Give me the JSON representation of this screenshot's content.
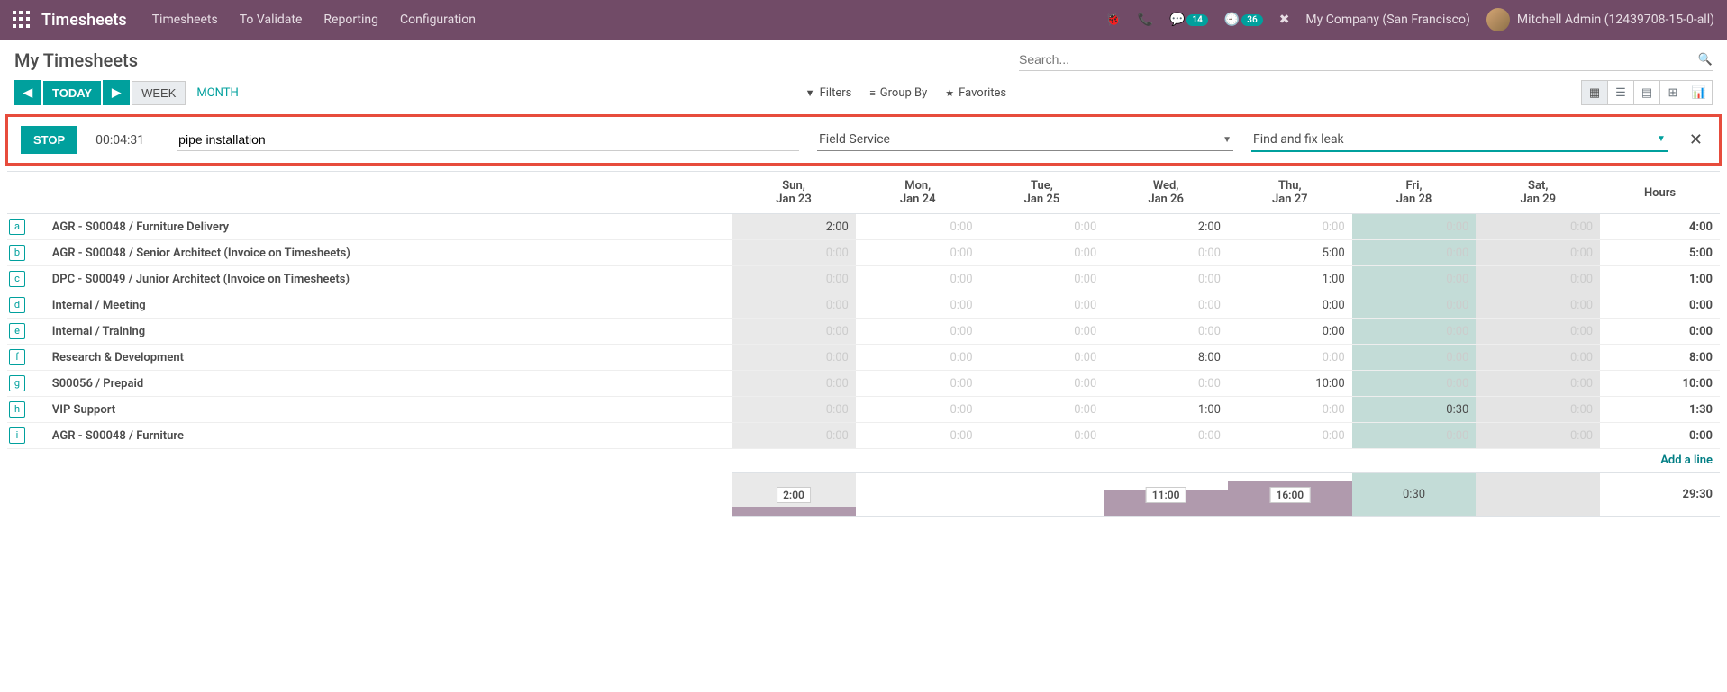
{
  "topbar": {
    "brand": "Timesheets",
    "nav": [
      "Timesheets",
      "To Validate",
      "Reporting",
      "Configuration"
    ],
    "messages_badge": "14",
    "activities_badge": "36",
    "company": "My Company (San Francisco)",
    "user": "Mitchell Admin (12439708-15-0-all)"
  },
  "header": {
    "title": "My Timesheets",
    "search_placeholder": "Search..."
  },
  "controls": {
    "today": "TODAY",
    "week": "WEEK",
    "month": "MONTH",
    "filters": "Filters",
    "group_by": "Group By",
    "favorites": "Favorites"
  },
  "timer": {
    "stop": "STOP",
    "elapsed": "00:04:31",
    "description": "pipe installation",
    "project": "Field Service",
    "task": "Find and fix leak"
  },
  "columns": {
    "sun": {
      "d": "Sun,",
      "n": "Jan 23"
    },
    "mon": {
      "d": "Mon,",
      "n": "Jan 24"
    },
    "tue": {
      "d": "Tue,",
      "n": "Jan 25"
    },
    "wed": {
      "d": "Wed,",
      "n": "Jan 26"
    },
    "thu": {
      "d": "Thu,",
      "n": "Jan 27"
    },
    "fri": {
      "d": "Fri,",
      "n": "Jan 28"
    },
    "sat": {
      "d": "Sat,",
      "n": "Jan 29"
    },
    "hours": "Hours"
  },
  "rows": [
    {
      "key": "a",
      "label": "AGR - S00048  /  Furniture Delivery",
      "cells": [
        "2:00",
        "0:00",
        "0:00",
        "2:00",
        "0:00",
        "0:00",
        "0:00"
      ],
      "total": "4:00",
      "nz": [
        0,
        3
      ]
    },
    {
      "key": "b",
      "label": "AGR - S00048  /  Senior Architect (Invoice on Timesheets)",
      "cells": [
        "0:00",
        "0:00",
        "0:00",
        "0:00",
        "5:00",
        "0:00",
        "0:00"
      ],
      "total": "5:00",
      "nz": [
        4
      ]
    },
    {
      "key": "c",
      "label": "DPC - S00049  /  Junior Architect (Invoice on Timesheets)",
      "cells": [
        "0:00",
        "0:00",
        "0:00",
        "0:00",
        "1:00",
        "0:00",
        "0:00"
      ],
      "total": "1:00",
      "nz": [
        4
      ]
    },
    {
      "key": "d",
      "label": "Internal  /  Meeting",
      "cells": [
        "0:00",
        "0:00",
        "0:00",
        "0:00",
        "0:00",
        "0:00",
        "0:00"
      ],
      "total": "0:00",
      "nz": [
        4
      ]
    },
    {
      "key": "e",
      "label": "Internal  /  Training",
      "cells": [
        "0:00",
        "0:00",
        "0:00",
        "0:00",
        "0:00",
        "0:00",
        "0:00"
      ],
      "total": "0:00",
      "nz": [
        4
      ]
    },
    {
      "key": "f",
      "label": "Research & Development",
      "cells": [
        "0:00",
        "0:00",
        "0:00",
        "8:00",
        "0:00",
        "0:00",
        "0:00"
      ],
      "total": "8:00",
      "nz": [
        3
      ]
    },
    {
      "key": "g",
      "label": "S00056  /  Prepaid",
      "cells": [
        "0:00",
        "0:00",
        "0:00",
        "0:00",
        "10:00",
        "0:00",
        "0:00"
      ],
      "total": "10:00",
      "nz": [
        4
      ]
    },
    {
      "key": "h",
      "label": "VIP Support",
      "cells": [
        "0:00",
        "0:00",
        "0:00",
        "1:00",
        "0:00",
        "0:30",
        "0:00"
      ],
      "total": "1:30",
      "nz": [
        3,
        5
      ]
    },
    {
      "key": "i",
      "label": "AGR - S00048  /  Furniture",
      "cells": [
        "0:00",
        "0:00",
        "0:00",
        "0:00",
        "0:00",
        "0:00",
        "0:00"
      ],
      "total": "0:00",
      "nz": []
    }
  ],
  "add_line": "Add a line",
  "footer": {
    "sun": "2:00",
    "wed": "11:00",
    "thu": "16:00",
    "fri": "0:30",
    "grand_total": "29:30"
  },
  "special_thu_vals": {
    "d": "0:00",
    "e": "0:00"
  }
}
